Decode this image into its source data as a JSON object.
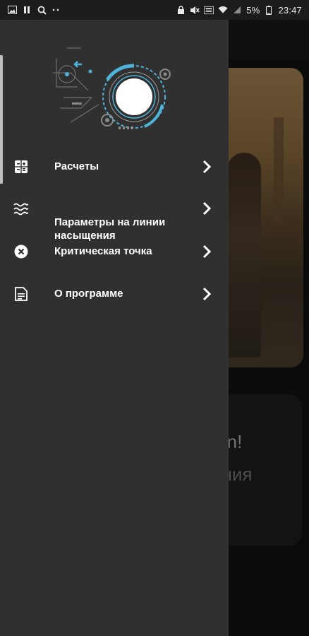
{
  "status_bar": {
    "battery_percent": "5%",
    "time": "23:47",
    "icons_left": [
      "image-icon",
      "pause-icon",
      "search-icon",
      "more-dots-icon"
    ],
    "icons_right": [
      "lock-icon",
      "mute-icon",
      "volte-icon",
      "wifi-icon",
      "signal-icon",
      "battery-icon"
    ]
  },
  "background": {
    "card_text_line1": "mn!",
    "card_text_line2": "ения"
  },
  "drawer": {
    "menu_items": [
      {
        "label": "Расчеты",
        "icon": "calculator-icon"
      },
      {
        "label": "Параметры на линии насыщения",
        "icon": "waves-icon"
      },
      {
        "label": "Критическая точка",
        "icon": "cancel-circle-icon"
      },
      {
        "label": "О программе",
        "icon": "document-icon"
      }
    ]
  },
  "colors": {
    "drawer_bg": "#303030",
    "accent": "#4fb3d9",
    "text": "#ffffff"
  }
}
